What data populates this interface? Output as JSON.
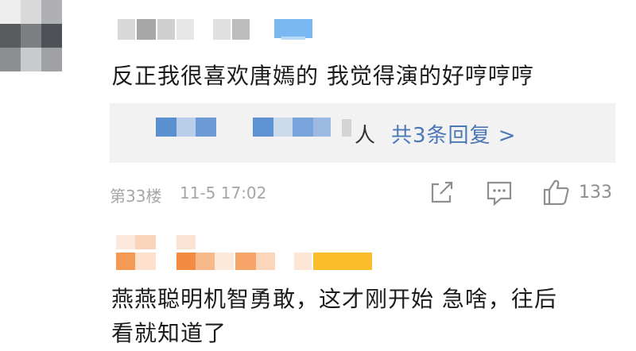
{
  "comments": [
    {
      "text": "反正我很喜欢唐嫣的 我觉得演的好哼哼哼",
      "reply_tail": "人",
      "reply_link": "共3条回复 >",
      "floor": "第33楼",
      "time": "11-5 17:02",
      "like_count": "133"
    },
    {
      "text_line1": "燕燕聪明机智勇敢，这才刚开始 急啥，往后",
      "text_line2": "看就知道了"
    }
  ],
  "icons": {
    "share": "share-icon",
    "comment": "comment-icon",
    "like": "thumbs-up-icon"
  },
  "colors": {
    "link": "#4d78b8",
    "meta": "#a6a6a6",
    "reply_bg": "#f2f2f2"
  }
}
